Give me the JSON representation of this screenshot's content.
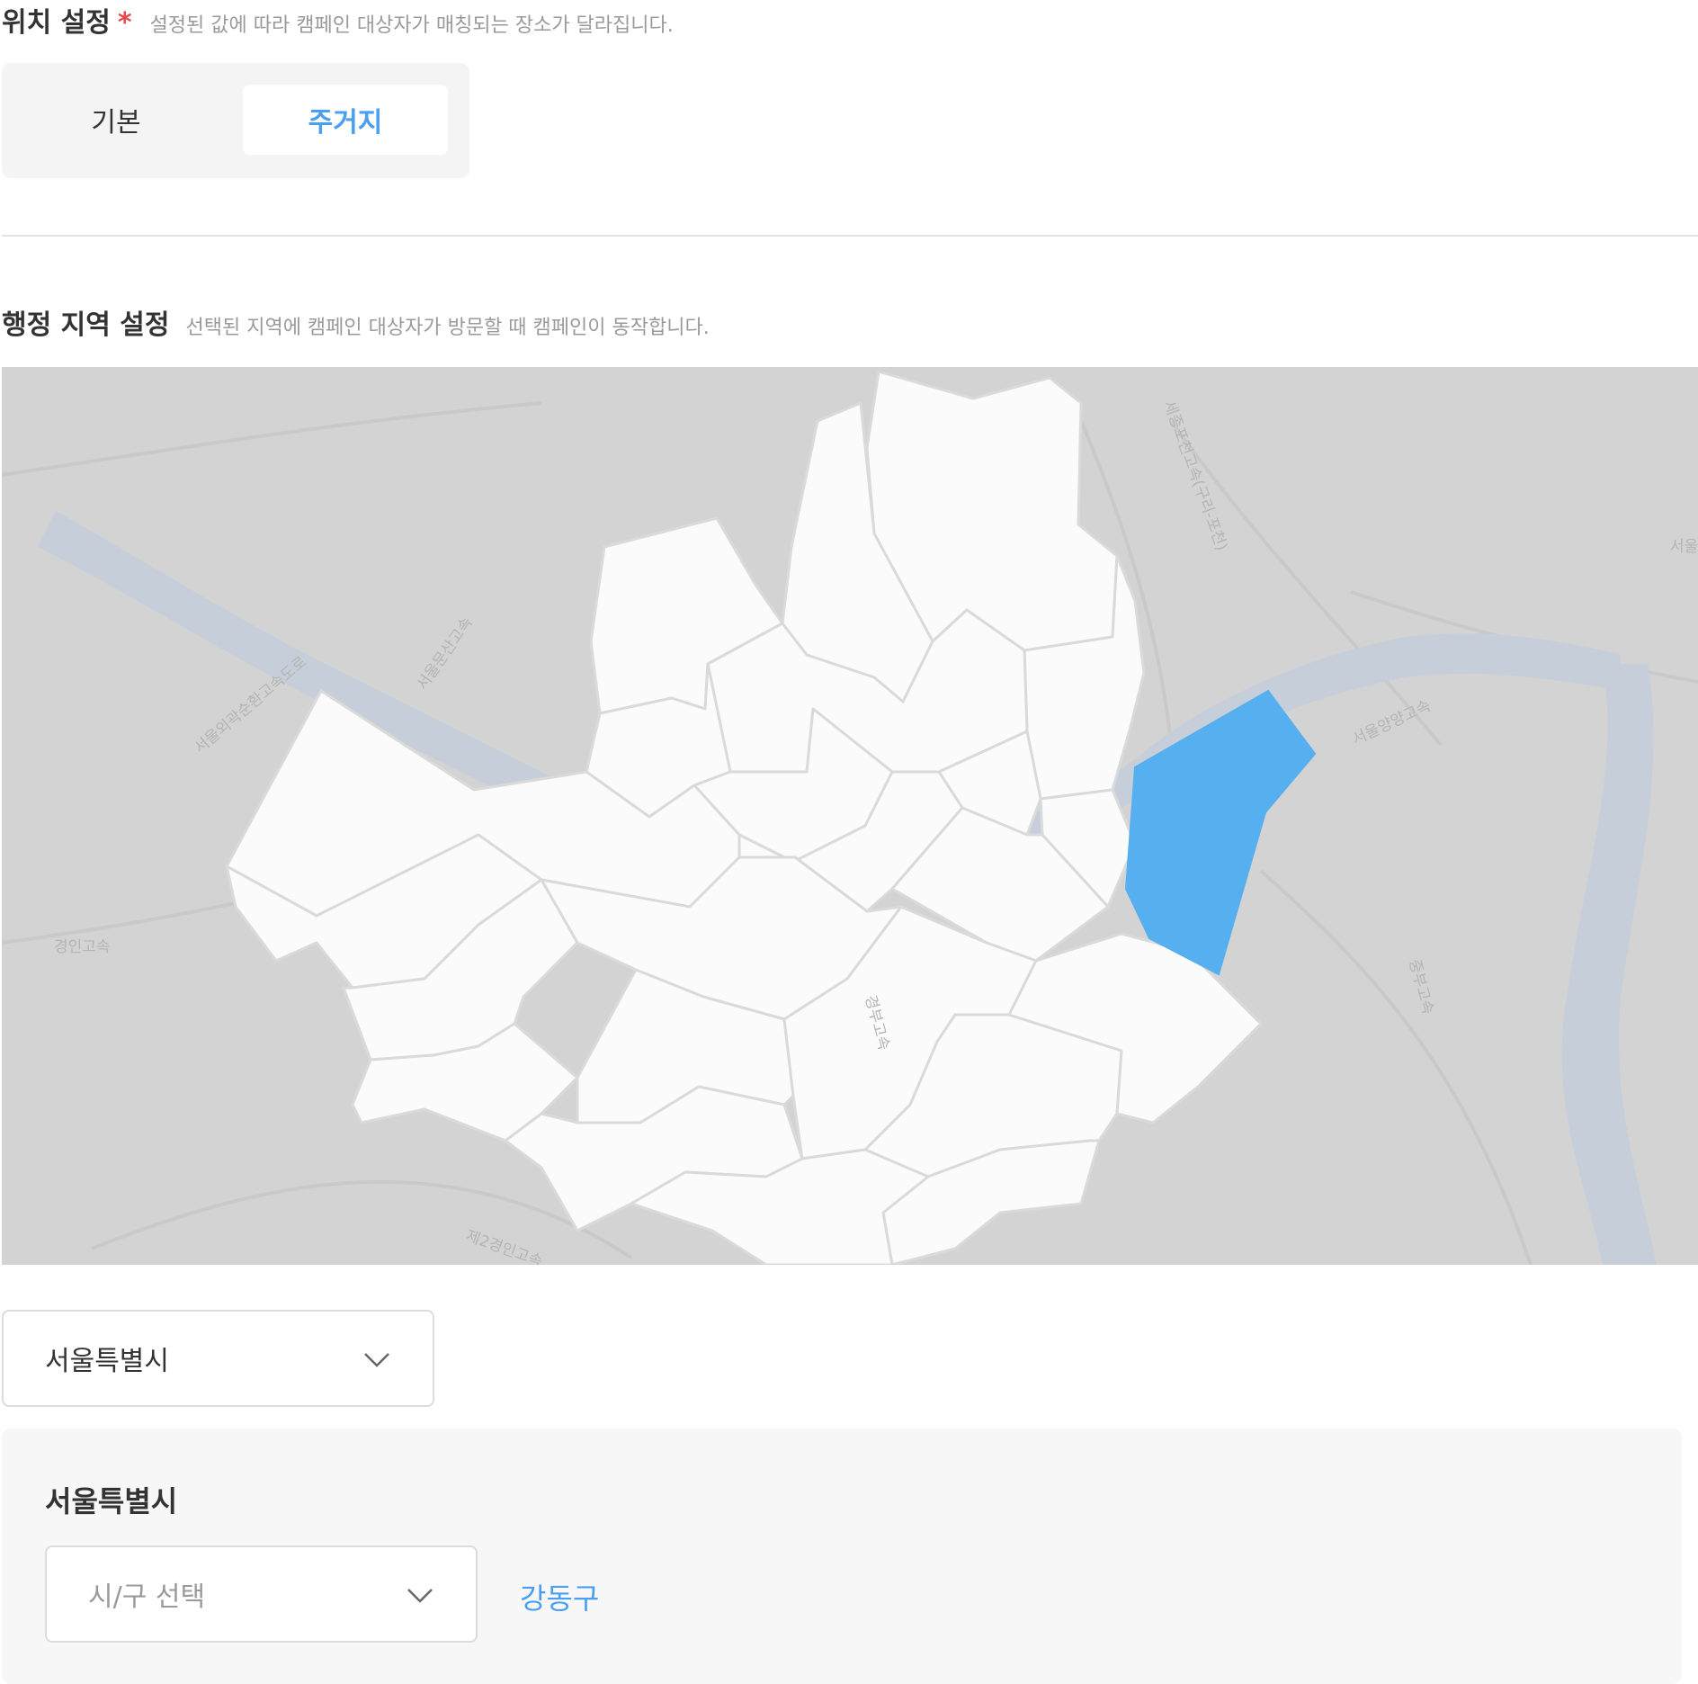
{
  "location": {
    "title": "위치 설정",
    "required_mark": "*",
    "description": "설정된 값에 따라 캠페인 대상자가 매칭되는 장소가 달라집니다.",
    "options": [
      {
        "label": "기본",
        "selected": false
      },
      {
        "label": "주거지",
        "selected": true
      }
    ]
  },
  "admin_region": {
    "title": "행정 지역 설정",
    "description": "선택된 지역에 캠페인 대상자가 방문할 때 캠페인이 동작합니다."
  },
  "map": {
    "selected_district": "강동구",
    "labels": [
      "서울외곽순환고속도로",
      "서울문산고속",
      "경인고속",
      "세종포천고속(구리-포천)",
      "서울양양고속",
      "경부고속",
      "중부고속",
      "제2경인고속",
      "서울"
    ],
    "colors": {
      "background": "#d3d3d4",
      "region_fill": "#fbfbfb",
      "region_border": "#dadada",
      "selected": "#56afef",
      "river": "#c6cfd9"
    }
  },
  "city_select": {
    "value": "서울특별시",
    "icon": "chevron-down-icon"
  },
  "region_panel": {
    "title": "서울특별시",
    "district_select": {
      "placeholder": "시/구 선택",
      "icon": "chevron-down-icon"
    },
    "selected_chips": [
      "강동구"
    ]
  },
  "theme": {
    "accent": "#4a9ff0",
    "required": "#e5484d"
  }
}
